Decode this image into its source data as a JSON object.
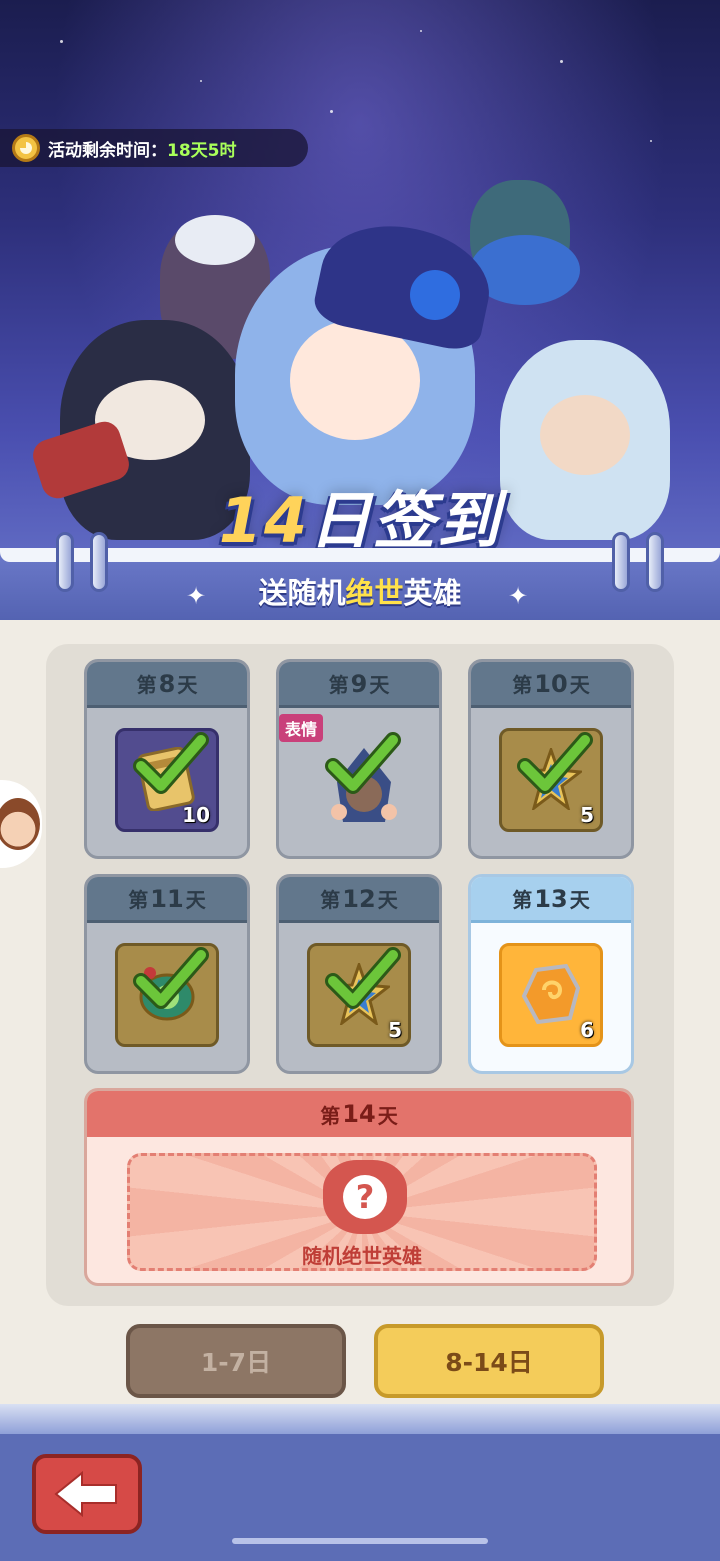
{
  "timer": {
    "label": "活动剩余时间：",
    "value": "18天5时"
  },
  "banner": {
    "title_number": "14",
    "title_text": "日签到",
    "subtitle_pre": "送随机",
    "subtitle_highlight": "绝世",
    "subtitle_post": "英雄"
  },
  "days": [
    {
      "prefix": "第",
      "number": "8",
      "suffix": "天",
      "quantity": "10",
      "claimed": true,
      "item": "book-icon"
    },
    {
      "prefix": "第",
      "number": "9",
      "suffix": "天",
      "quantity": "",
      "claimed": true,
      "item": "emote-hero-icon",
      "tag": "表情"
    },
    {
      "prefix": "第",
      "number": "10",
      "suffix": "天",
      "quantity": "5",
      "claimed": true,
      "item": "star-shard-icon"
    },
    {
      "prefix": "第",
      "number": "11",
      "suffix": "天",
      "quantity": "",
      "claimed": true,
      "item": "compass-icon"
    },
    {
      "prefix": "第",
      "number": "12",
      "suffix": "天",
      "quantity": "5",
      "claimed": true,
      "item": "star-shard-icon"
    },
    {
      "prefix": "第",
      "number": "13",
      "suffix": "天",
      "quantity": "6",
      "claimed": false,
      "item": "fire-stone-icon"
    }
  ],
  "day14": {
    "prefix": "第",
    "number": "14",
    "suffix": "天",
    "reward_label": "随机绝世英雄"
  },
  "tabs": [
    {
      "label": "1-7日",
      "active": false
    },
    {
      "label": "8-14日",
      "active": true
    }
  ],
  "colors": {
    "claimed_check": "#6cc63a",
    "active_tab": "#f4cc5a",
    "day14_header": "#e3736b"
  }
}
